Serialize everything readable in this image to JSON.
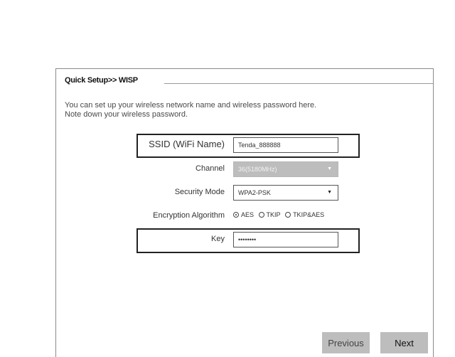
{
  "panel": {
    "title": "Quick Setup>> WISP",
    "description": [
      "You can set up your wireless network name and wireless password here.",
      "Note down your wireless password."
    ]
  },
  "form": {
    "ssid": {
      "label": "SSID (WiFi Name)",
      "value": "Tenda_888888"
    },
    "channel": {
      "label": "Channel",
      "value": "36(5180MHz)"
    },
    "security_mode": {
      "label": "Security Mode",
      "value": "WPA2-PSK"
    },
    "encryption": {
      "label": "Encryption Algorithm",
      "options": [
        "AES",
        "TKIP",
        "TKIP&AES"
      ],
      "selected": "AES"
    },
    "key": {
      "label": "Key",
      "value": "••••••••"
    }
  },
  "buttons": {
    "previous": "Previous",
    "next": "Next"
  },
  "icons": {
    "dropdown": "▼"
  },
  "colors": {
    "button_background": "#bdbdbd",
    "disabled_select": "#bdbdbd",
    "highlight_border": "#222222"
  }
}
